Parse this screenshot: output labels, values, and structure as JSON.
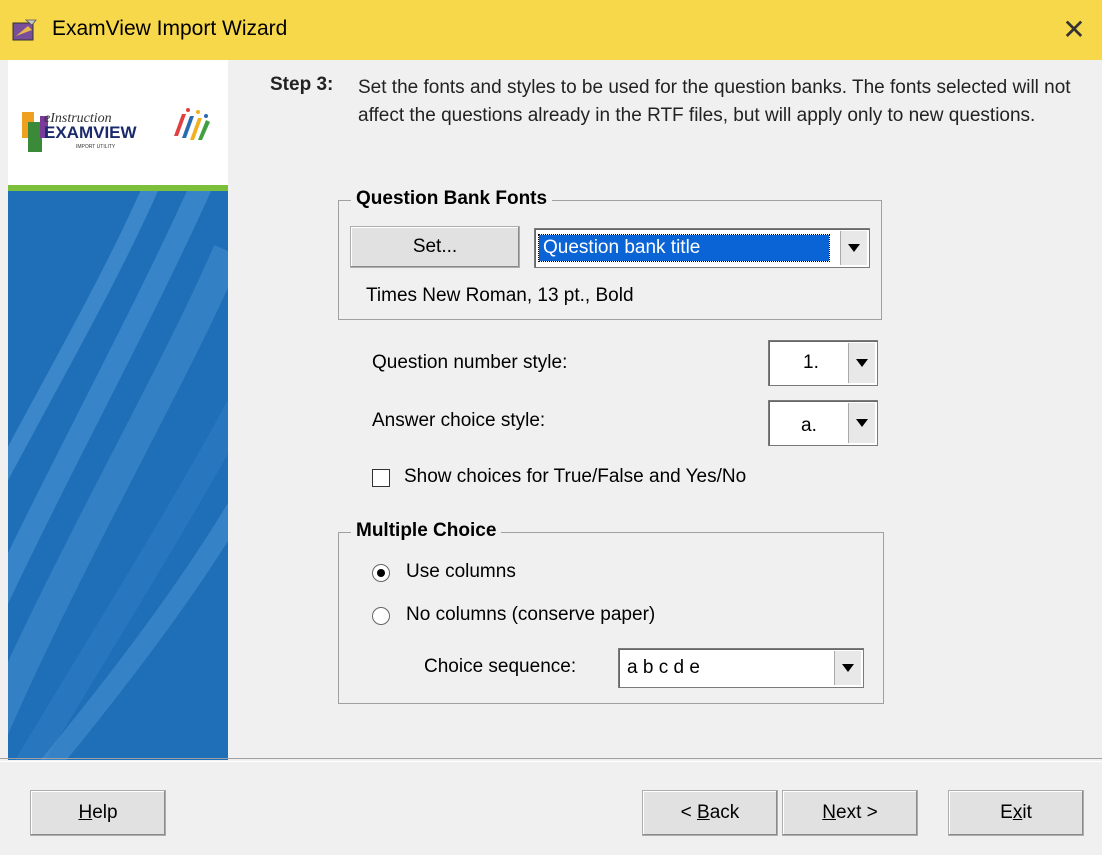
{
  "window": {
    "title": "ExamView Import Wizard",
    "close_label": "✕"
  },
  "logo": {
    "line1": "eInstruction",
    "line2": "EXAMVIEW",
    "line3": "IMPORT UTILITY"
  },
  "step": {
    "label": "Step 3:",
    "text": "Set the fonts and styles to be used for the question banks.  The fonts selected will not affect the questions already in the RTF files, but will apply only to new questions."
  },
  "fonts_group": {
    "title": "Question Bank Fonts",
    "set_button": "Set...",
    "font_target": "Question bank title",
    "font_desc": "Times New Roman, 13 pt., Bold"
  },
  "styles": {
    "question_number_label": "Question number style:",
    "question_number_value": "1.",
    "answer_choice_label": "Answer choice style:",
    "answer_choice_value": "a.",
    "show_choices_label": "Show choices for True/False and Yes/No",
    "show_choices_checked": false
  },
  "multiple_choice": {
    "title": "Multiple Choice",
    "use_columns": "Use columns",
    "no_columns": "No columns (conserve paper)",
    "selected": "use_columns",
    "sequence_label": "Choice sequence:",
    "sequence_value": "a b c d e"
  },
  "buttons": {
    "help_u": "H",
    "help_rest": "elp",
    "back_pre": "< ",
    "back_u": "B",
    "back_rest": "ack",
    "next_u": "N",
    "next_rest": "ext >",
    "exit_pre": "E",
    "exit_u": "x",
    "exit_rest": "it"
  },
  "colors": {
    "title_bar": "#f7d84a",
    "side_panel": "#1e6fb8",
    "selection": "#0a64d6"
  }
}
